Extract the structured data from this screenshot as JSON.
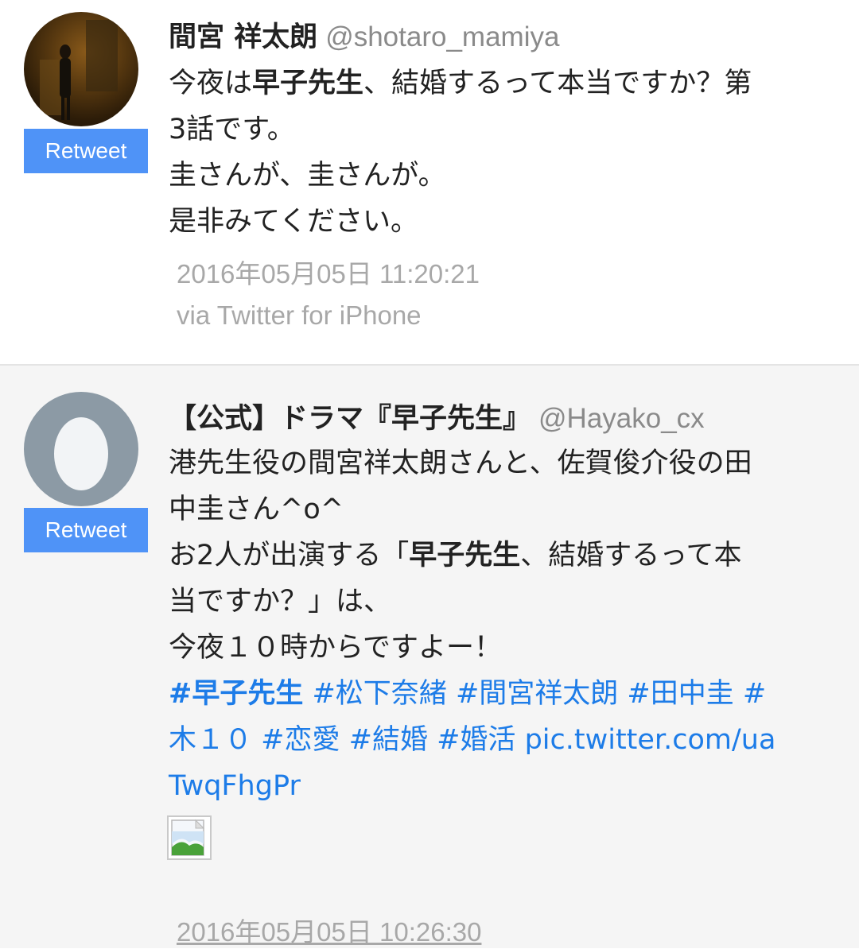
{
  "tweets": [
    {
      "name": "間宮 祥太朗",
      "handle": "@shotaro_mamiya",
      "retweet_label": "Retweet",
      "lines": [
        [
          {
            "t": "今夜は",
            "s": ""
          },
          {
            "t": "早子先生",
            "s": "bold"
          },
          {
            "t": "、結婚するって本当ですか？第",
            "s": ""
          }
        ],
        [
          {
            "t": "3話です。",
            "s": ""
          }
        ],
        [
          {
            "t": "圭さんが、圭さんが。",
            "s": ""
          }
        ],
        [
          {
            "t": "是非みてください。",
            "s": ""
          }
        ]
      ],
      "timestamp": "2016年05月05日 11:20:21",
      "via": "via Twitter for iPhone"
    },
    {
      "name": "【公式】ドラマ『早子先生』",
      "handle": "@Hayako_cx",
      "retweet_label": "Retweet",
      "lines": [
        [
          {
            "t": "港先生役の間宮祥太朗さんと、佐賀俊介役の田",
            "s": ""
          }
        ],
        [
          {
            "t": "中圭さん^o^",
            "s": ""
          }
        ],
        [
          {
            "t": "お2人が出演する「",
            "s": ""
          },
          {
            "t": "早子先生",
            "s": "bold"
          },
          {
            "t": "、結婚するって本",
            "s": ""
          }
        ],
        [
          {
            "t": "当ですか？」は、",
            "s": ""
          }
        ],
        [
          {
            "t": "今夜１０時からですよー！",
            "s": ""
          }
        ],
        [
          {
            "t": "#早子先生",
            "s": "tag bold"
          },
          {
            "t": " ",
            "s": ""
          },
          {
            "t": "#松下奈緒",
            "s": "tag"
          },
          {
            "t": " ",
            "s": ""
          },
          {
            "t": "#間宮祥太朗",
            "s": "tag"
          },
          {
            "t": " ",
            "s": ""
          },
          {
            "t": "#田中圭",
            "s": "tag"
          },
          {
            "t": " ",
            "s": ""
          },
          {
            "t": "#",
            "s": "tag"
          }
        ],
        [
          {
            "t": "木１０",
            "s": "tag"
          },
          {
            "t": " ",
            "s": ""
          },
          {
            "t": "#恋愛",
            "s": "tag"
          },
          {
            "t": " ",
            "s": ""
          },
          {
            "t": "#結婚",
            "s": "tag"
          },
          {
            "t": " ",
            "s": ""
          },
          {
            "t": "#婚活",
            "s": "tag"
          },
          {
            "t": " ",
            "s": ""
          },
          {
            "t": "pic.twitter.com/ua",
            "s": "tag"
          }
        ],
        [
          {
            "t": "TwqFhgPr",
            "s": "tag"
          }
        ]
      ],
      "timestamp": "2016年05月05日 10:26:30"
    }
  ],
  "colors": {
    "retweet_button": "#4f93f7",
    "link": "#1d7ce8",
    "meta_text": "#a8a8a8",
    "default_avatar": "#8c9aa5"
  },
  "icons": {
    "avatar_1": "profile-photo",
    "avatar_2": "default-egg-avatar",
    "image": "broken-image-icon"
  }
}
